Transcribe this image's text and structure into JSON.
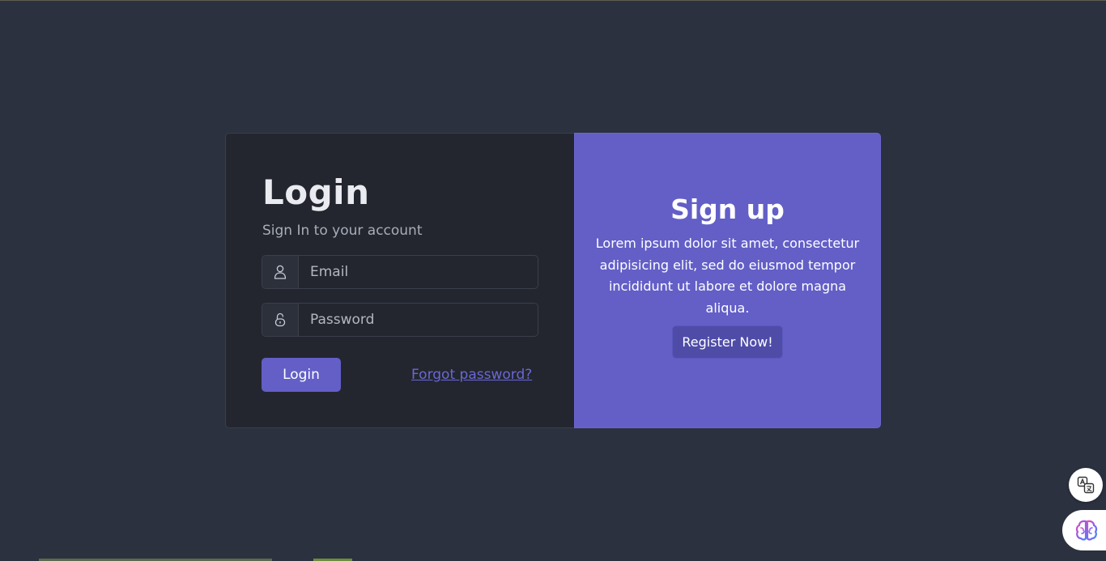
{
  "login": {
    "title": "Login",
    "subtitle": "Sign In to your account",
    "email_placeholder": "Email",
    "password_placeholder": "Password",
    "login_button": "Login",
    "forgot_password": "Forgot password?"
  },
  "signup": {
    "title": "Sign up",
    "text": "Lorem ipsum dolor sit amet, consectetur adipisicing elit, sed do eiusmod tempor incididunt ut labore et dolore magna aliqua.",
    "register_button": "Register Now!"
  },
  "icons": {
    "email": "user-icon",
    "password": "lock-icon",
    "translate": "translate-icon",
    "assistant": "brain-icon"
  },
  "colors": {
    "background": "#2c313f",
    "card": "#23262f",
    "accent": "#635fc7"
  }
}
